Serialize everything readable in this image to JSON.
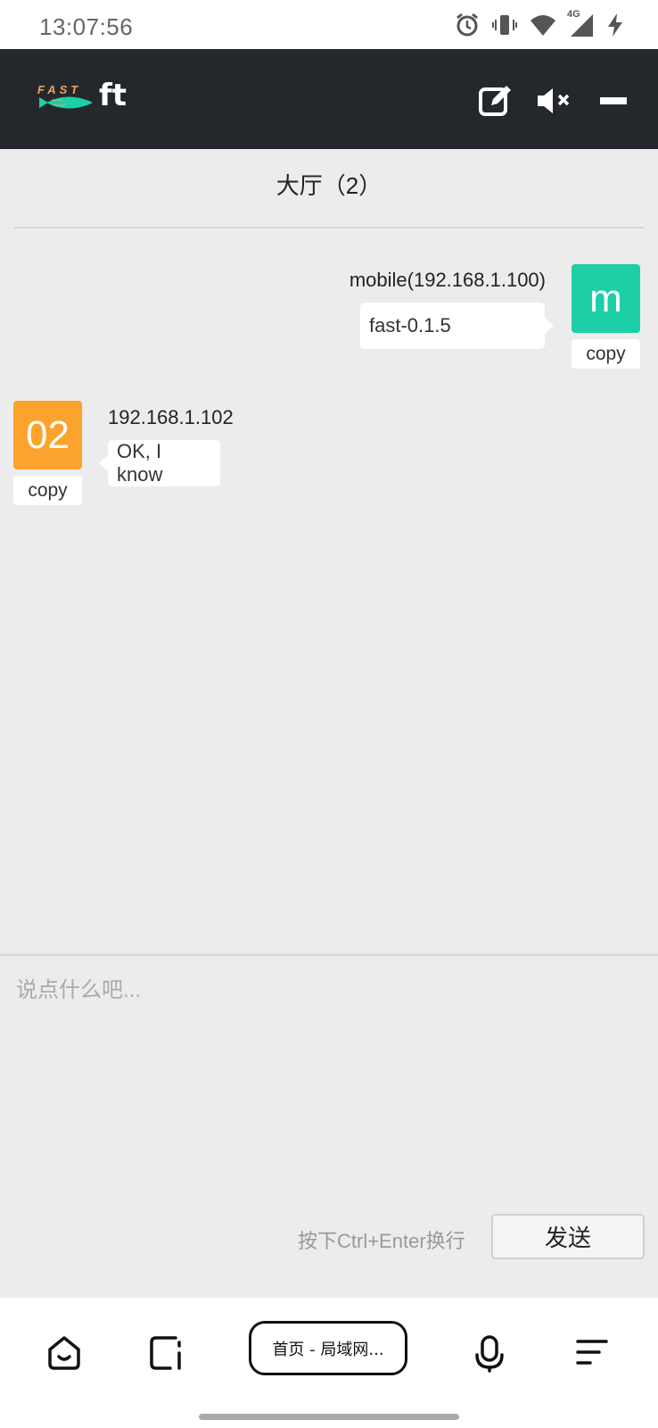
{
  "status_bar": {
    "time": "13:07:56",
    "icons": [
      "alarm-icon",
      "vibrate-icon",
      "wifi-icon",
      "signal-4g-icon",
      "charging-icon"
    ],
    "network_label": "4G"
  },
  "app_header": {
    "logo_small": "FAST",
    "logo_text": "ft",
    "actions": [
      "edit-icon",
      "mute-icon",
      "minimize-icon"
    ]
  },
  "room": {
    "title": "大厅（2）"
  },
  "messages": [
    {
      "side": "right",
      "avatar_text": "m",
      "avatar_color": "#1ccfa6",
      "sender": "mobile(192.168.1.100)",
      "text": "fast-0.1.5",
      "copy_label": "copy"
    },
    {
      "side": "left",
      "avatar_text": "02",
      "avatar_color": "#fba32c",
      "sender": "192.168.1.102",
      "text": "OK, I know",
      "copy_label": "copy"
    }
  ],
  "composer": {
    "placeholder": "说点什么吧...",
    "value": "",
    "hint": "按下Ctrl+Enter换行",
    "send_label": "发送"
  },
  "browser_nav": {
    "tab_label": "首页 - 局域网...",
    "icons": [
      "home-icon",
      "tabs-icon",
      "mic-icon",
      "menu-icon"
    ]
  }
}
